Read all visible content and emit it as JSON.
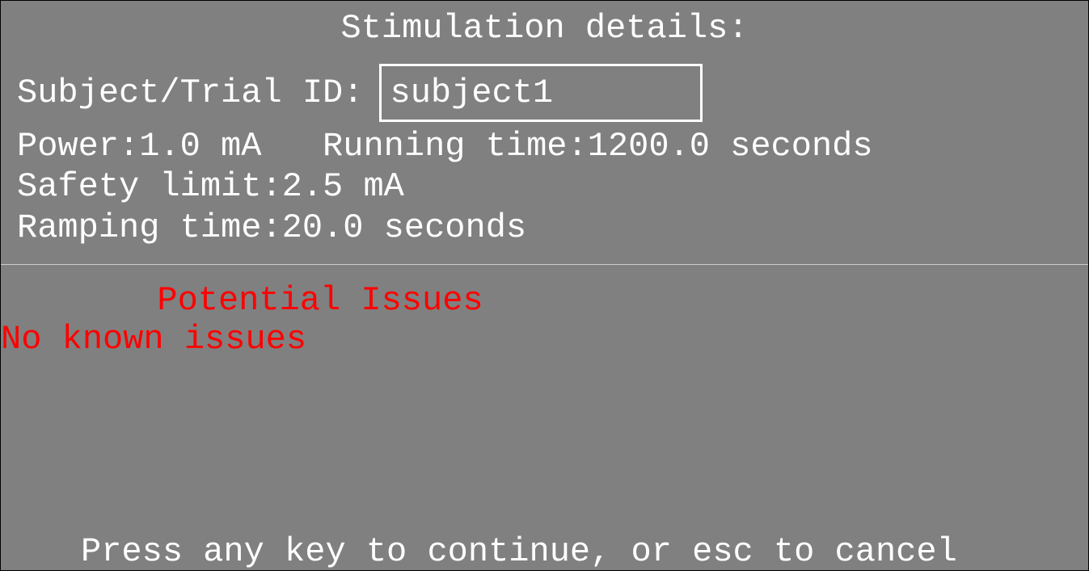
{
  "title": "Stimulation details:",
  "subject": {
    "label": "Subject/Trial ID:",
    "value": "subject1"
  },
  "power": {
    "label": "Power:",
    "value": "1.0",
    "unit": "mA"
  },
  "runningTime": {
    "label": "Running time:",
    "value": "1200.0",
    "unit": "seconds"
  },
  "safetyLimit": {
    "label": "Safety limit:",
    "value": "2.5",
    "unit": "mA"
  },
  "rampingTime": {
    "label": "Ramping time:",
    "value": "20.0",
    "unit": "seconds"
  },
  "issues": {
    "title": "Potential Issues",
    "text": "No known issues"
  },
  "prompt": "Press any key to continue, or esc to cancel",
  "composed": {
    "powerLine": "Power:1.0 mA   Running time:1200.0 seconds",
    "safetyLine": "Safety limit:2.5 mA",
    "rampingLine": "Ramping time:20.0 seconds"
  }
}
